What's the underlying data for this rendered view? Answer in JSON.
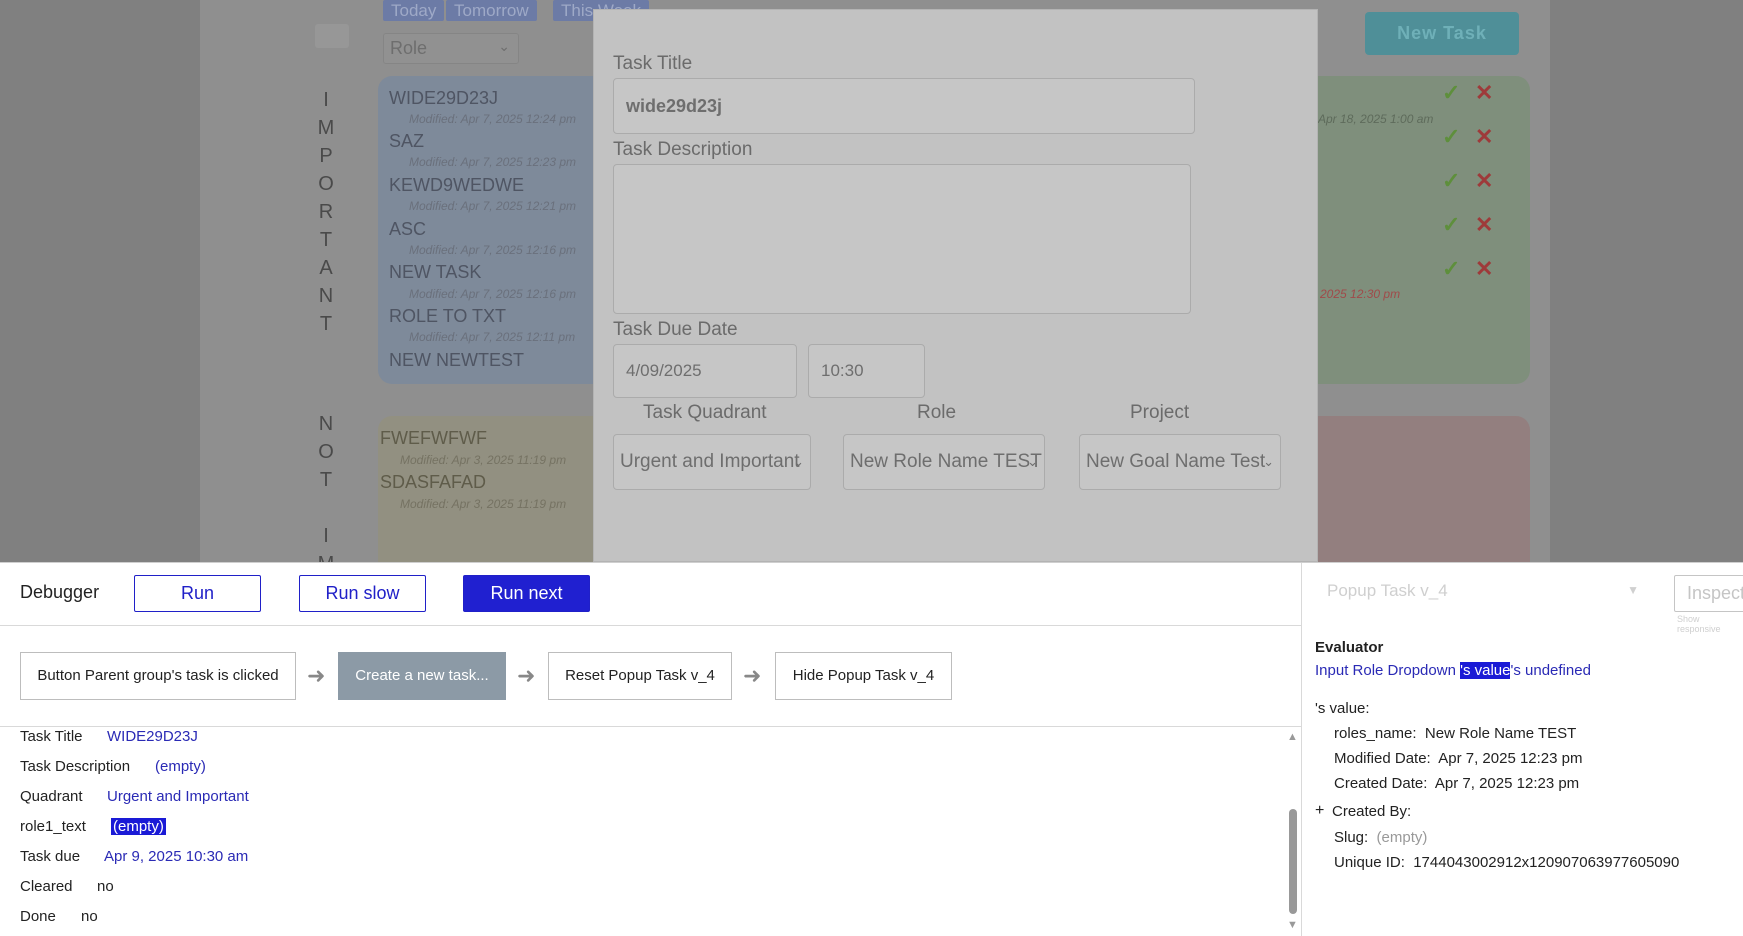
{
  "background_app": {
    "filters": [
      "Today",
      "Tomorrow",
      "This Week"
    ],
    "role_placeholder": "Role",
    "new_task_label": "New Task",
    "important_label": [
      "I",
      "M",
      "P",
      "O",
      "R",
      "T",
      "A",
      "N",
      "T"
    ],
    "not_label": [
      "N",
      "O",
      "T"
    ],
    "not_important_label": [
      "I",
      "M"
    ],
    "blue_tasks": [
      {
        "name": "WIDE29D23J",
        "modified": "Modified: Apr 7, 2025 12:24 pm"
      },
      {
        "name": "SAZ",
        "modified": "Modified: Apr 7, 2025 12:23 pm"
      },
      {
        "name": "KEWD9WEDWE",
        "modified": "Modified: Apr 7, 2025 12:21 pm"
      },
      {
        "name": "ASC",
        "modified": "Modified: Apr 7, 2025 12:16 pm"
      },
      {
        "name": "NEW TASK",
        "modified": "Modified: Apr 7, 2025 12:16 pm"
      },
      {
        "name": "ROLE TO TXT",
        "modified": "Modified: Apr 7, 2025 12:11 pm"
      },
      {
        "name": "NEW NEWTEST",
        "modified": ""
      }
    ],
    "yellow_tasks": [
      {
        "name": "FWEFWFWF",
        "modified": "Modified: Apr 3, 2025 11:19 pm"
      },
      {
        "name": "SDASFAFAD",
        "modified": "Modified: Apr 3, 2025 11:19 pm"
      }
    ],
    "green_modified_first": "Apr 18, 2025 1:00 am",
    "green_modified_red": "2025 12:30 pm"
  },
  "popup": {
    "title_label": "Task Title",
    "title_value": "wide29d23j",
    "description_label": "Task Description",
    "description_value": "",
    "due_label": "Task Due Date",
    "due_date": "4/09/2025",
    "due_time": "10:30",
    "quadrant_label": "Task Quadrant",
    "quadrant_value": "Urgent and Important",
    "role_label": "Role",
    "role_value": "New Role Name TEST",
    "project_label": "Project",
    "project_value": "New Goal Name Test"
  },
  "debugger": {
    "title": "Debugger",
    "run": "Run",
    "run_slow": "Run slow",
    "run_next": "Run next",
    "steps": [
      "Button Parent group's task is clicked",
      "Create a new task...",
      "Reset Popup Task v_4",
      "Hide Popup Task v_4"
    ],
    "properties": [
      {
        "key": "Task Title",
        "value": "WIDE29D23J"
      },
      {
        "key": "Task Description",
        "value": "(empty)"
      },
      {
        "key": "Quadrant",
        "value": "Urgent and Important"
      },
      {
        "key": "role1_text",
        "value": "(empty)"
      },
      {
        "key": "Task due",
        "value": "Apr 9, 2025 10:30 am"
      },
      {
        "key": "Cleared",
        "value": "no"
      },
      {
        "key": "Done",
        "value": "no"
      }
    ],
    "element_select": "Popup Task v_4",
    "inspect": "Inspect",
    "show_responsive": "Show responsive",
    "evaluator": {
      "title": "Evaluator",
      "expr_prefix": "Input Role Dropdown ",
      "expr_selected": "'s value",
      "expr_suffix": "'s undefined",
      "value_heading": "'s value:",
      "fields": [
        {
          "key": "roles_name:",
          "value": "New Role Name TEST"
        },
        {
          "key": "Modified Date:",
          "value": "Apr 7, 2025 12:23 pm"
        },
        {
          "key": "Created Date:",
          "value": "Apr 7, 2025 12:23 pm"
        }
      ],
      "created_by": "Created By:",
      "slug_key": "Slug:",
      "slug_value": "(empty)",
      "uid_key": "Unique ID:",
      "uid_value": "1744043002912x120907063977605090"
    }
  },
  "colors": {
    "accent": "#2020d0",
    "link": "#2a2ab5",
    "step_active": "#8c9aa6"
  }
}
